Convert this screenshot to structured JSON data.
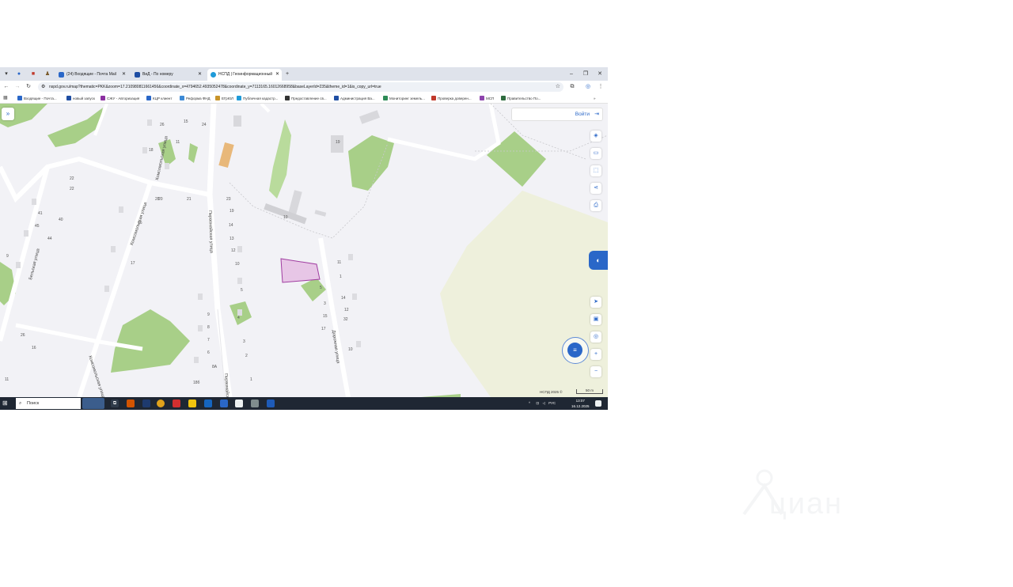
{
  "browser": {
    "tabs": [
      {
        "label": "(24) Входящие - Почта Mail",
        "icon_color": "#2a67c8"
      },
      {
        "label": "ВиД - По номеру",
        "icon_color": "#1f4ea3"
      },
      {
        "label": "НСПД | Геоинформационный",
        "icon_color": "#1f9bd9"
      }
    ],
    "new_tab": "+",
    "url": "nspd.gov.ru/map?thematic=PKK&zoom=17.210980811661456&coordinate_x=4794652.4935052478&coordinate_y=7113165.16012668958&baseLayerId=235&theme_id=1&is_copy_url=true",
    "bookmarks": [
      {
        "label": "Входящие - Почта...",
        "color": "#2a67c8"
      },
      {
        "label": "новый запуск",
        "color": "#1f4ea3"
      },
      {
        "label": "СЖУ - Авторизация",
        "color": "#8b2fa0"
      },
      {
        "label": "КЦР клиент",
        "color": "#2a67c8"
      },
      {
        "label": "Реформа ФНД",
        "color": "#3c8ad6"
      },
      {
        "label": "ЕГрЮЛ",
        "color": "#c8942a"
      },
      {
        "label": "Публичная кадастр...",
        "color": "#1f9bd9"
      },
      {
        "label": "Предоставление св...",
        "color": "#333333"
      },
      {
        "label": "Администрация Ва...",
        "color": "#1f4ea3"
      },
      {
        "label": "Мониторинг земель...",
        "color": "#2e8b57"
      },
      {
        "label": "Проверка доверен...",
        "color": "#c0392b"
      },
      {
        "label": "МСП",
        "color": "#8e44ad"
      },
      {
        "label": "Правительство По...",
        "color": "#2e6b3f"
      }
    ],
    "bookmarks_more": "»"
  },
  "map": {
    "login_label": "Войти",
    "expand_icon": "»",
    "copyright": "НСПД 2025 ©",
    "scale_label": "50 m",
    "streets": [
      "Комсомольская улица",
      "Комсомольская улица",
      "Комсомольская улица",
      "Первомайская улица",
      "Первомайская улица",
      "Бельская улица",
      "Дорожная улица"
    ],
    "house_numbers": [
      "26",
      "15",
      "24",
      "18",
      "11",
      "22",
      "21",
      "20",
      "16",
      "17",
      "23",
      "19",
      "14",
      "13",
      "12",
      "10",
      "9",
      "8",
      "7",
      "6",
      "5",
      "4",
      "3",
      "2",
      "1",
      "8А",
      "19",
      "11",
      "1",
      "5",
      "3",
      "15",
      "17",
      "14",
      "12",
      "10",
      "28",
      "22",
      "44",
      "40",
      "41",
      "45",
      "9",
      "18б",
      "32",
      "26",
      "16",
      "11"
    ],
    "building_label": "10"
  },
  "taskbar": {
    "search_placeholder": "Поиск",
    "language": "РУС",
    "time": "13:07",
    "date": "16.12.2025"
  },
  "watermark": {
    "text": "циан"
  },
  "colors": {
    "accent": "#2a67c8",
    "parcel_fill": "#e7c6e6",
    "parcel_stroke": "#a03ca0",
    "vegetation": "#a8cf88",
    "field": "#eef0dc"
  }
}
